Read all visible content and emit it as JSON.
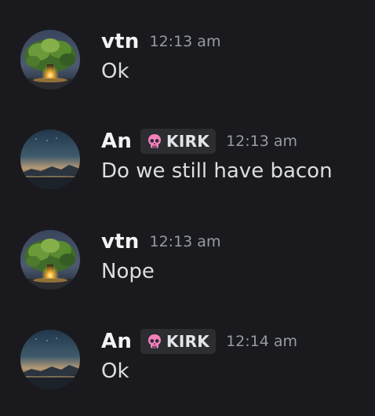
{
  "messages": [
    {
      "username": "vtn",
      "tag": "",
      "time": "12:13 am",
      "text": "Ok",
      "avatar": "tree-avatar"
    },
    {
      "username": "An",
      "tag": "KIRK",
      "tag_icon": "skull-icon",
      "time": "12:13 am",
      "text": "Do we still have bacon",
      "avatar": "sunset-avatar"
    },
    {
      "username": "vtn",
      "tag": "",
      "time": "12:13 am",
      "text": "Nope",
      "avatar": "tree-avatar"
    },
    {
      "username": "An",
      "tag": "KIRK",
      "tag_icon": "skull-icon",
      "time": "12:14 am",
      "text": "Ok",
      "avatar": "sunset-avatar"
    }
  ],
  "colors": {
    "background": "#1a1a1e",
    "username": "#f2f3f5",
    "message_text": "#dbdee1",
    "timestamp": "#949ba4",
    "tag_background": "#2b2d31",
    "skull": "#f47fba"
  }
}
